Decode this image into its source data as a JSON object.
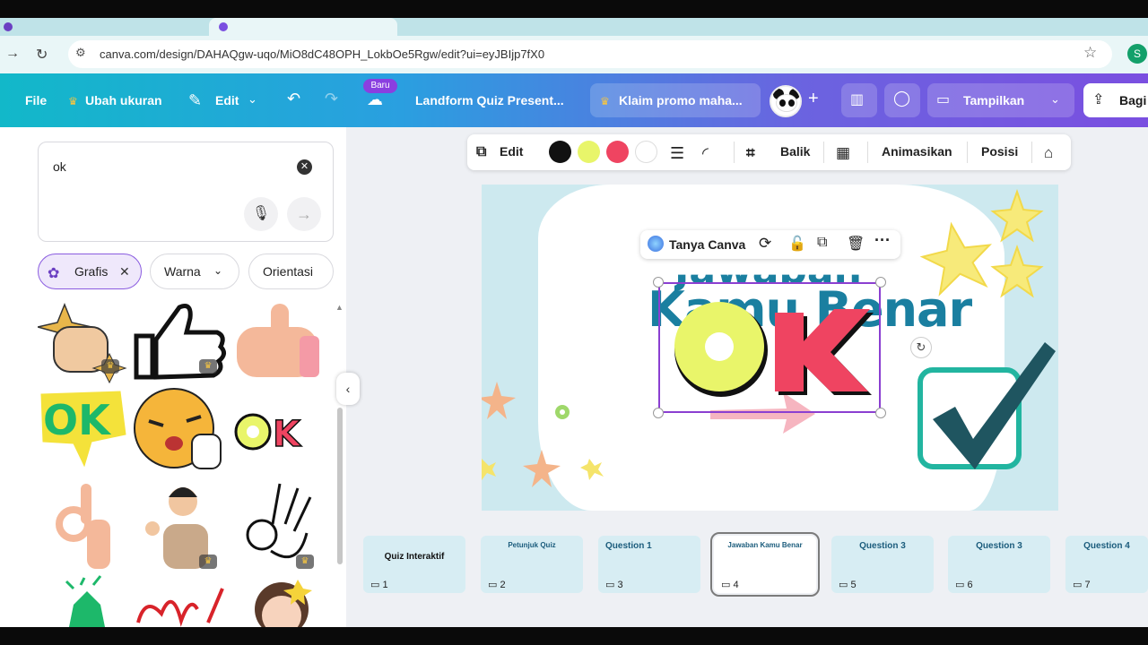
{
  "browser": {
    "url": "canva.com/design/DAHAQgw-uqo/MiO8dC48OPH_LokbOe5Rgw/edit?ui=eyJBIjp7fX0",
    "profile_initial": "S"
  },
  "toolbar": {
    "file": "File",
    "resize": "Ubah ukuran",
    "edit": "Edit",
    "new_badge": "Baru",
    "doc_title": "Landform Quiz Present...",
    "promo": "Klaim promo maha...",
    "present": "Tampilkan",
    "share": "Bagi"
  },
  "search": {
    "query": "ok"
  },
  "filters": {
    "graphics": "Grafis",
    "color": "Warna",
    "orientation": "Orientasi"
  },
  "results": [
    {
      "name": "thumbs-up-sparkle-sticker",
      "premium": true
    },
    {
      "name": "thumbs-up-outline-sticker",
      "premium": true
    },
    {
      "name": "thumbs-up-hand-sticker",
      "premium": false
    },
    {
      "name": "ok-speech-bubble-sticker",
      "premium": false
    },
    {
      "name": "emoji-ok-hand-sticker",
      "premium": false
    },
    {
      "name": "ok-lettering-sticker",
      "premium": false
    },
    {
      "name": "ok-hand-gesture-sticker",
      "premium": false
    },
    {
      "name": "boy-ok-gesture-sticker",
      "premium": true
    },
    {
      "name": "ok-hand-outline-sticker",
      "premium": true
    },
    {
      "name": "green-sticker",
      "premium": false
    },
    {
      "name": "red-scribble-sticker",
      "premium": false
    },
    {
      "name": "girl-wink-sticker",
      "premium": false
    }
  ],
  "context_toolbar": {
    "edit": "Edit",
    "flip": "Balik",
    "animate": "Animasikan",
    "position": "Posisi",
    "swatches": [
      "#111111",
      "#e8f56a",
      "#ef4461",
      "#ffffff"
    ]
  },
  "float_toolbar": {
    "ask": "Tanya Canva"
  },
  "slide": {
    "top_word": "Jawaban",
    "headline": "Kamu Benar",
    "ok_word": "OK"
  },
  "thumbnails": [
    {
      "num": "1",
      "title": "Quiz Interaktif"
    },
    {
      "num": "2",
      "title": "Petunjuk Quiz"
    },
    {
      "num": "3",
      "title": "Question 1"
    },
    {
      "num": "4",
      "title": "Jawaban Kamu Benar"
    },
    {
      "num": "5",
      "title": "Question 3"
    },
    {
      "num": "6",
      "title": "Question 3"
    },
    {
      "num": "7",
      "title": "Question 4"
    }
  ]
}
